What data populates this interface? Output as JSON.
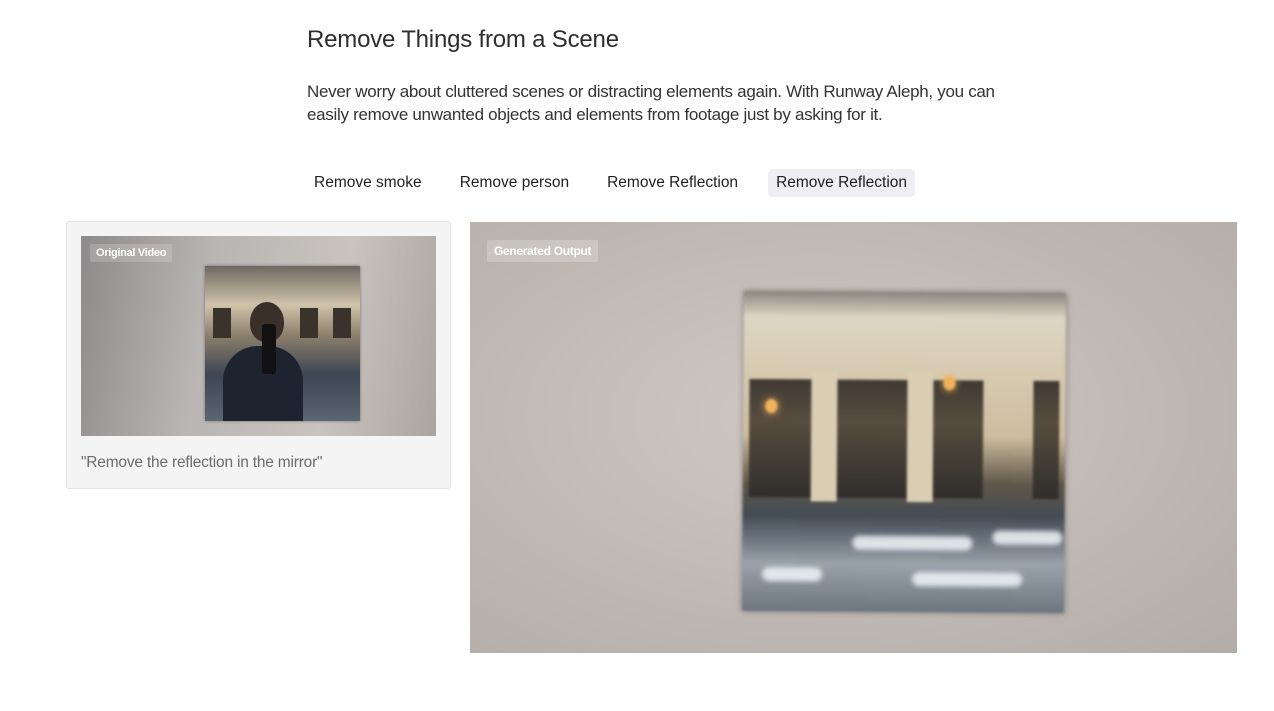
{
  "section": {
    "title": "Remove Things from a Scene",
    "description": "Never worry about cluttered scenes or distracting elements again. With Runway Aleph, you can easily remove unwanted objects and elements from footage just by asking for it."
  },
  "tabs": [
    {
      "label": "Remove smoke",
      "active": false
    },
    {
      "label": "Remove person",
      "active": false
    },
    {
      "label": "Remove Reflection",
      "active": false
    },
    {
      "label": "Remove Reflection",
      "active": true
    }
  ],
  "original": {
    "label": "Original Video",
    "prompt": "\"Remove the reflection in the mirror\""
  },
  "output": {
    "label": "Generated Output"
  },
  "colors": {
    "active_tab_bg": "#eeeef3",
    "card_bg": "#f4f4f4"
  }
}
